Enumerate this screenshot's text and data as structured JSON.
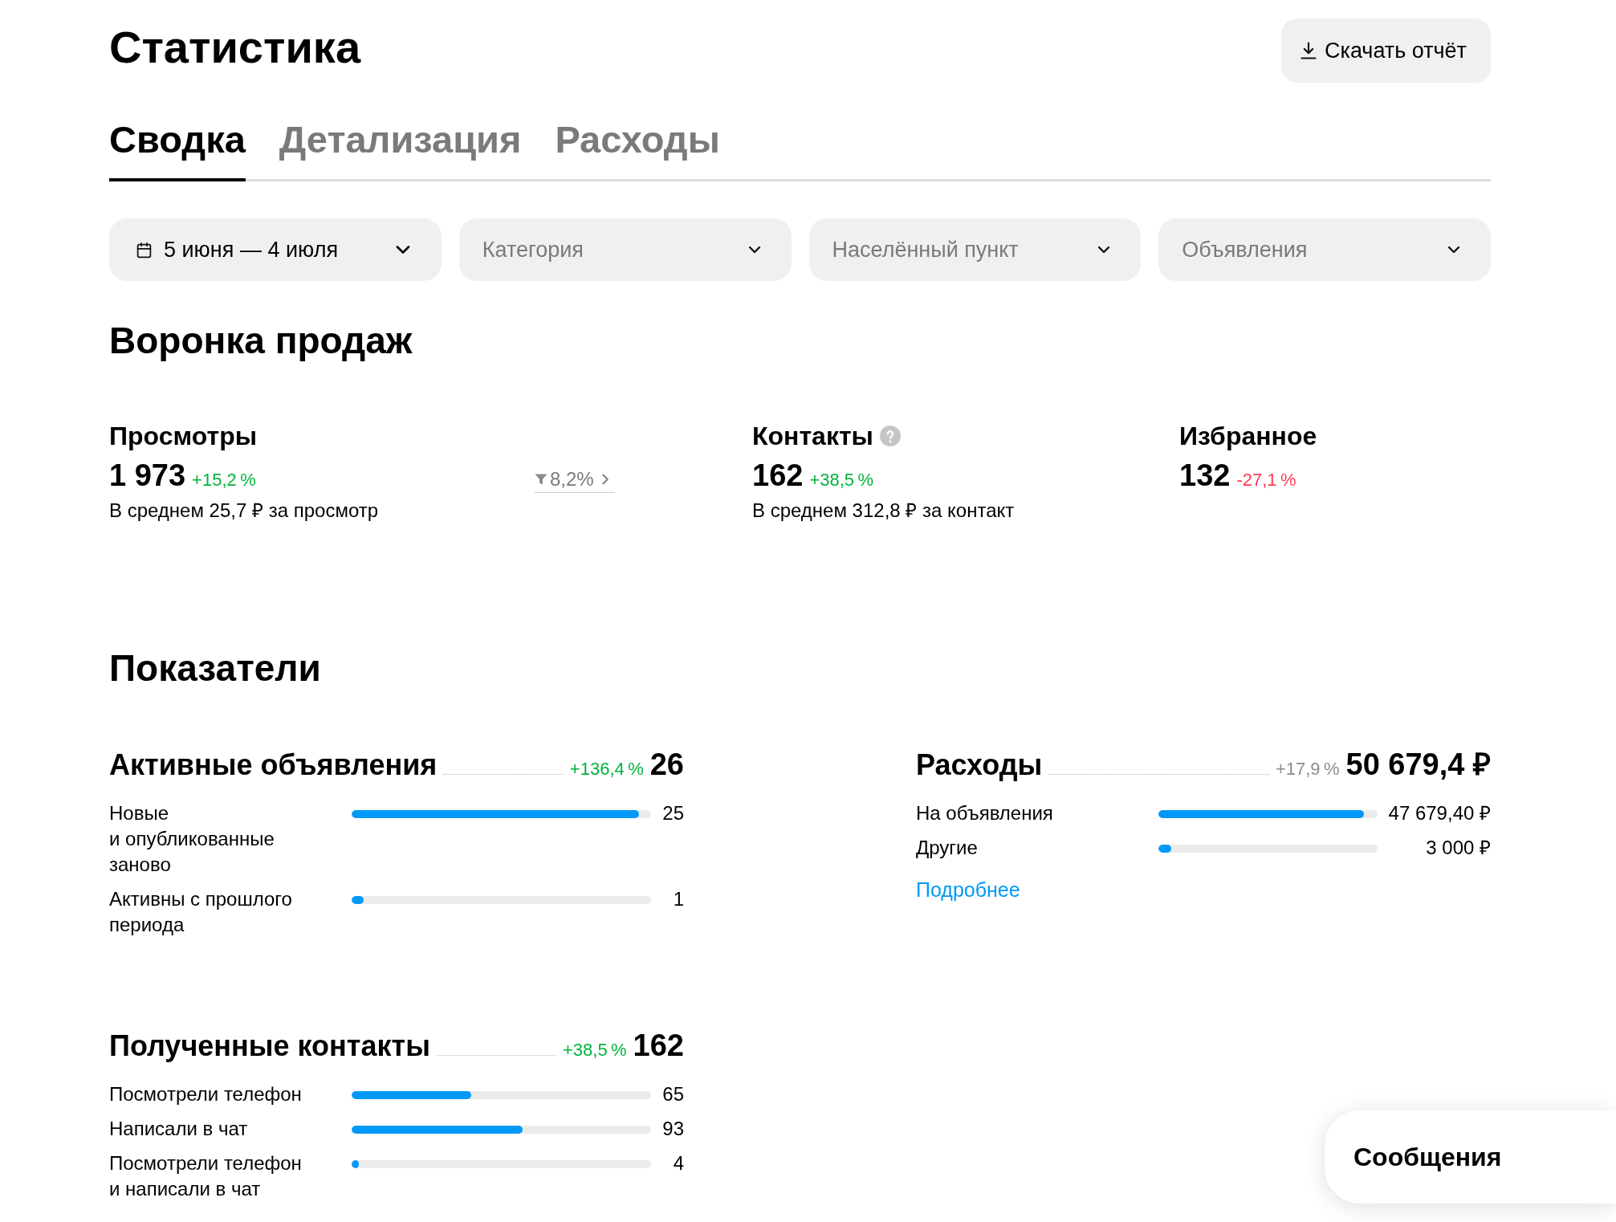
{
  "page": {
    "title": "Статистика",
    "download_button": "Скачать отчёт"
  },
  "tabs": [
    {
      "label": "Сводка",
      "selected": true
    },
    {
      "label": "Детализация",
      "selected": false
    },
    {
      "label": "Расходы",
      "selected": false
    }
  ],
  "filters": [
    {
      "kind": "date",
      "value": "5 июня — 4 июля"
    },
    {
      "kind": "select",
      "placeholder": "Категория"
    },
    {
      "kind": "select",
      "placeholder": "Населённый пункт"
    },
    {
      "kind": "select",
      "placeholder": "Объявления"
    }
  ],
  "funnel": {
    "title": "Воронка продаж",
    "metrics": [
      {
        "label": "Просмотры",
        "value": "1 973",
        "change": {
          "text": "+15,2 %",
          "color": "#00b33c"
        },
        "note": "В среднем 25,7 ₽ за просмотр",
        "conversion": "8,2%"
      },
      {
        "label": "Контакты",
        "help": true,
        "value": "162",
        "change": {
          "text": "+38,5 %",
          "color": "#00b33c"
        },
        "note": "В среднем 312,8 ₽ за контакт"
      },
      {
        "label": "Избранное",
        "value": "132",
        "change": {
          "text": "-27,1 %",
          "color": "#ff3b4f"
        }
      }
    ]
  },
  "indicators": {
    "title": "Показатели",
    "columns": [
      {
        "groups": [
          {
            "title": "Активные объявления",
            "change": {
              "text": "+136,4 %",
              "color": "#00b33c"
            },
            "total": "26",
            "rows": [
              {
                "label": "Новые и опубликованные заново",
                "level": 0.96,
                "value": "25"
              },
              {
                "label": "Активны с прошлого периода",
                "level": 0.04,
                "value": "1"
              }
            ]
          },
          {
            "title": "Полученные контакты",
            "change": {
              "text": "+38,5 %",
              "color": "#00b33c"
            },
            "total": "162",
            "rows": [
              {
                "label": "Посмотрели телефон",
                "level": 0.4,
                "value": "65"
              },
              {
                "label": "Написали в чат",
                "level": 0.57,
                "value": "93"
              },
              {
                "label": "Посмотрели телефон и написали в чат",
                "level": 0.025,
                "value": "4"
              }
            ]
          }
        ]
      },
      {
        "groups": [
          {
            "title": "Расходы",
            "change": {
              "text": "+17,9 %",
              "color": "#8c8c8c"
            },
            "total": "50 679,4 ₽",
            "rows": [
              {
                "label": "На объявления",
                "level": 0.94,
                "value": "47 679,40 ₽"
              },
              {
                "label": "Другие",
                "level": 0.06,
                "value": "3 000 ₽"
              }
            ],
            "link": "Подробнее"
          }
        ]
      }
    ]
  },
  "messages": {
    "label": "Сообщения"
  }
}
